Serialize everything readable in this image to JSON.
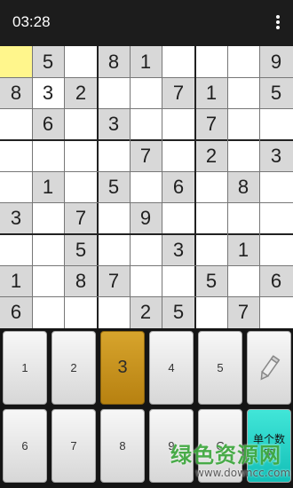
{
  "status": {
    "time": "03:28"
  },
  "app": {
    "menu_icon": "more-vertical-icon"
  },
  "board": {
    "grid": [
      [
        "",
        "5",
        "",
        "8",
        "1",
        "",
        "",
        "",
        "9"
      ],
      [
        "8",
        "3",
        "2",
        "",
        "",
        "7",
        "1",
        "",
        "5"
      ],
      [
        "",
        "6",
        "",
        "3",
        "",
        "",
        "7",
        "",
        ""
      ],
      [
        "",
        "",
        "",
        "",
        "7",
        "",
        "2",
        "",
        "3"
      ],
      [
        "",
        "1",
        "",
        "5",
        "",
        "6",
        "",
        "8",
        ""
      ],
      [
        "3",
        "",
        "7",
        "",
        "9",
        "",
        "",
        "",
        ""
      ],
      [
        "",
        "",
        "5",
        "",
        "",
        "3",
        "",
        "1",
        ""
      ],
      [
        "1",
        "",
        "8",
        "7",
        "",
        "",
        "5",
        "",
        "6"
      ],
      [
        "6",
        "",
        "",
        "",
        "2",
        "5",
        "",
        "7",
        ""
      ]
    ],
    "shaded": [
      [
        0,
        1,
        0,
        1,
        1,
        0,
        0,
        0,
        1
      ],
      [
        1,
        0,
        1,
        0,
        0,
        1,
        1,
        0,
        1
      ],
      [
        0,
        1,
        0,
        1,
        0,
        0,
        1,
        0,
        0
      ],
      [
        0,
        0,
        0,
        0,
        1,
        0,
        1,
        0,
        1
      ],
      [
        0,
        1,
        0,
        1,
        0,
        1,
        0,
        1,
        0
      ],
      [
        1,
        0,
        1,
        0,
        1,
        0,
        0,
        0,
        0
      ],
      [
        0,
        0,
        1,
        0,
        0,
        1,
        0,
        1,
        0
      ],
      [
        1,
        0,
        1,
        1,
        0,
        0,
        1,
        0,
        1
      ],
      [
        1,
        0,
        0,
        0,
        1,
        1,
        0,
        1,
        0
      ]
    ],
    "selected": [
      0,
      0
    ],
    "colors": {
      "white": "#ffffff",
      "shade": "#d8d8d8",
      "selected": "#fff68c"
    }
  },
  "keypad": {
    "row1": [
      "1",
      "2",
      "3",
      "4",
      "5"
    ],
    "row2": [
      "6",
      "7",
      "8",
      "9",
      "C"
    ],
    "pencil_icon": "pencil-icon",
    "mode_label": "单个数字",
    "selected_key": "3"
  },
  "watermark": {
    "text": "绿色资源网",
    "sub": "www.downcc.com"
  }
}
